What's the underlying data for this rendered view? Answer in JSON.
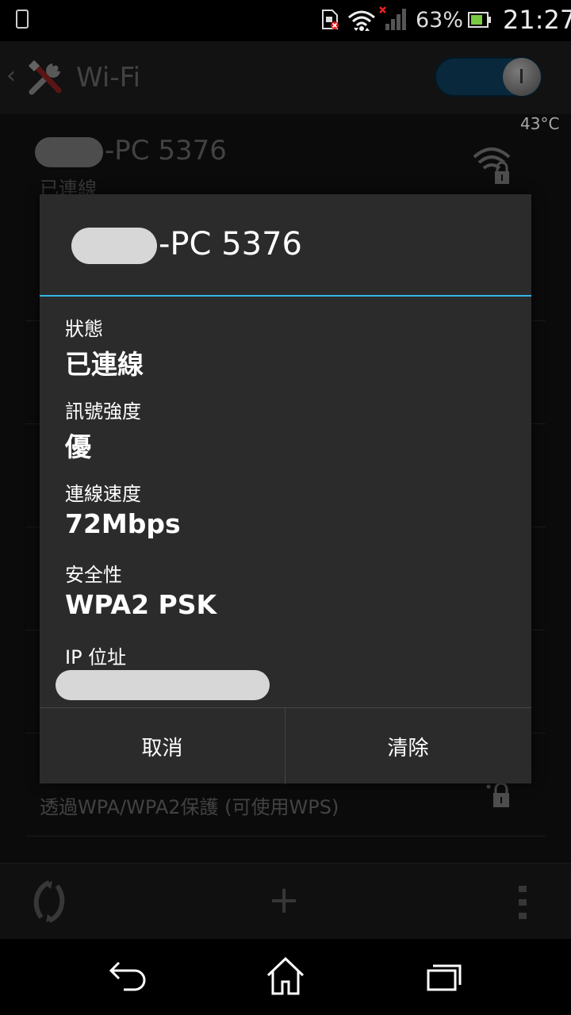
{
  "status_bar": {
    "battery_percent": "63%",
    "time": "21:27"
  },
  "action_bar": {
    "title": "Wi-Fi",
    "wifi_toggle_on": true
  },
  "temperature": "43°C",
  "background_list": {
    "network_name_suffix": "-PC 5376",
    "network_status": "已連線",
    "other_network_security": "透過WPA/WPA2保護 (可使用WPS)"
  },
  "bottom_bar": {
    "add_symbol": "+"
  },
  "dialog": {
    "title_suffix": "-PC 5376",
    "rows": [
      {
        "label": "狀態",
        "value": "已連線"
      },
      {
        "label": "訊號強度",
        "value": "優"
      },
      {
        "label": "連線速度",
        "value": "72Mbps"
      },
      {
        "label": "安全性",
        "value": "WPA2 PSK"
      },
      {
        "label": "IP 位址",
        "value": ""
      }
    ],
    "cancel_label": "取消",
    "clear_label": "清除"
  },
  "colors": {
    "accent": "#33b5e5",
    "dialog_bg": "#2b2b2b",
    "toggle_track": "#0e3e5b"
  }
}
